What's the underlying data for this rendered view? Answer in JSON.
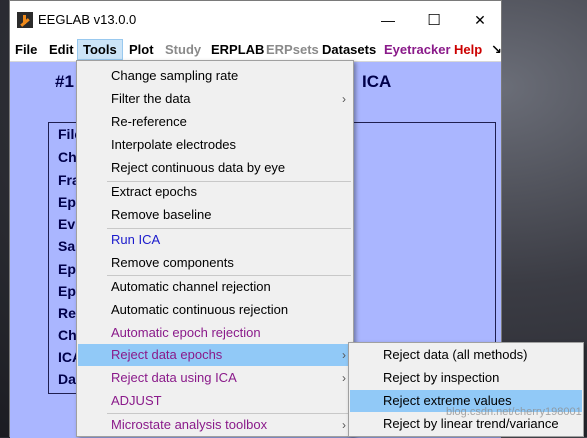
{
  "window": {
    "title": "EEGLAB v13.0.0",
    "controls": {
      "minimize": "—",
      "maximize": "☐",
      "close": "✕"
    }
  },
  "menubar": {
    "items": [
      {
        "label": "File",
        "color": "#000000"
      },
      {
        "label": "Edit",
        "color": "#000000"
      },
      {
        "label": "Tools",
        "color": "#000000",
        "active": true
      },
      {
        "label": "Plot",
        "color": "#000000"
      },
      {
        "label": "Study",
        "color": "#8a8a8a"
      },
      {
        "label": "ERPLAB",
        "color": "#000000"
      },
      {
        "label": "ERPsets",
        "color": "#8a8a8a"
      },
      {
        "label": "Datasets",
        "color": "#000000"
      },
      {
        "label": "Eyetracker",
        "color": "#8a1a8a"
      },
      {
        "label": "Help",
        "color": "#cc0000"
      },
      {
        "label": "↘",
        "color": "#000000"
      }
    ]
  },
  "main": {
    "heading_left": "#1",
    "heading_right": "ICA",
    "panel_labels": [
      "File",
      "Ch",
      "Fra",
      "Ep",
      "Ev",
      "Sa",
      "Ep",
      "Ep",
      "Re",
      "Ch",
      "ICA",
      "Da"
    ]
  },
  "tools_menu": {
    "items": [
      {
        "label": "Change sampling rate",
        "submenu": false
      },
      {
        "label": "Filter the data",
        "submenu": true
      },
      {
        "label": "Re-reference",
        "submenu": false
      },
      {
        "label": "Interpolate electrodes",
        "submenu": false
      },
      {
        "label": "Reject continuous data by eye",
        "submenu": false
      },
      {
        "label": "Extract epochs",
        "submenu": false
      },
      {
        "label": "Remove baseline",
        "submenu": false
      },
      {
        "label": "Run ICA",
        "submenu": false
      },
      {
        "label": "Remove components",
        "submenu": false
      },
      {
        "label": "Automatic channel rejection",
        "submenu": false
      },
      {
        "label": "Automatic continuous rejection",
        "submenu": false
      },
      {
        "label": "Automatic epoch rejection",
        "submenu": false
      },
      {
        "label": "Reject data epochs",
        "submenu": true
      },
      {
        "label": "Reject data using ICA",
        "submenu": true
      },
      {
        "label": "ADJUST",
        "submenu": false
      },
      {
        "label": "Microstate analysis toolbox",
        "submenu": true
      }
    ],
    "highlighted": "Reject data epochs"
  },
  "reject_epochs_submenu": {
    "items": [
      {
        "label": "Reject data (all methods)"
      },
      {
        "label": "Reject by inspection"
      },
      {
        "label": "Reject extreme values"
      },
      {
        "label": "Reject by linear trend/variance"
      }
    ],
    "highlighted": "Reject extreme values"
  },
  "watermark": "blog.csdn.net/cherry198001",
  "colors": {
    "client_bg": "#aab6ff",
    "highlight": "#91c9f7",
    "blue_item": "#1a1acc",
    "purple_item": "#8a1a8a"
  }
}
